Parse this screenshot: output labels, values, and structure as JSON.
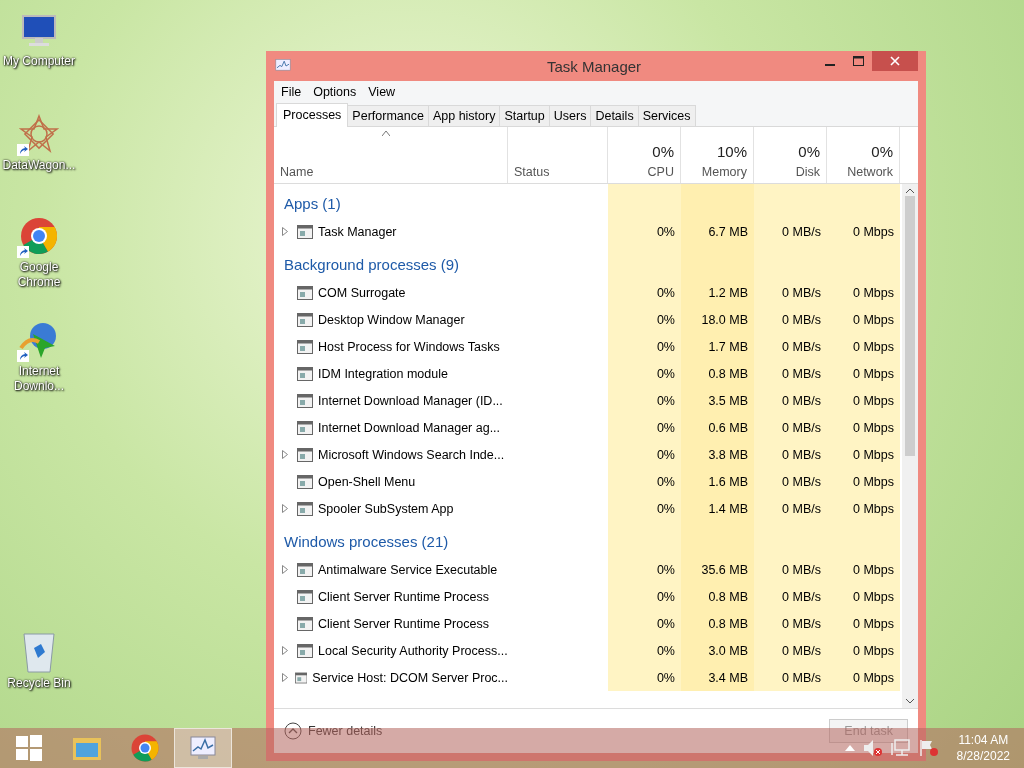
{
  "desktop_icons": [
    {
      "label": "My Computer"
    },
    {
      "label": "DataWagon..."
    },
    {
      "label": "Google Chrome"
    },
    {
      "label": "Internet Downlo..."
    }
  ],
  "recycle_bin": {
    "label": "Recycle Bin"
  },
  "window": {
    "title": "Task Manager"
  },
  "menu": [
    "File",
    "Options",
    "View"
  ],
  "tabs": [
    {
      "label": "Processes",
      "selected": true
    },
    {
      "label": "Performance",
      "selected": false
    },
    {
      "label": "App history",
      "selected": false
    },
    {
      "label": "Startup",
      "selected": false
    },
    {
      "label": "Users",
      "selected": false
    },
    {
      "label": "Details",
      "selected": false
    },
    {
      "label": "Services",
      "selected": false
    }
  ],
  "columns": [
    {
      "label": "Name"
    },
    {
      "label": "Status"
    },
    {
      "label": "CPU",
      "total": "0%"
    },
    {
      "label": "Memory",
      "total": "10%"
    },
    {
      "label": "Disk",
      "total": "0%"
    },
    {
      "label": "Network",
      "total": "0%"
    }
  ],
  "groups": [
    {
      "title": "Apps (1)",
      "rows": [
        {
          "name": "Task Manager",
          "expandable": true,
          "cpu": "0%",
          "memory": "6.7 MB",
          "disk": "0 MB/s",
          "network": "0 Mbps"
        }
      ]
    },
    {
      "title": "Background processes (9)",
      "rows": [
        {
          "name": "COM Surrogate",
          "expandable": false,
          "cpu": "0%",
          "memory": "1.2 MB",
          "disk": "0 MB/s",
          "network": "0 Mbps"
        },
        {
          "name": "Desktop Window Manager",
          "expandable": false,
          "cpu": "0%",
          "memory": "18.0 MB",
          "disk": "0 MB/s",
          "network": "0 Mbps"
        },
        {
          "name": "Host Process for Windows Tasks",
          "expandable": false,
          "cpu": "0%",
          "memory": "1.7 MB",
          "disk": "0 MB/s",
          "network": "0 Mbps"
        },
        {
          "name": "IDM Integration module",
          "expandable": false,
          "cpu": "0%",
          "memory": "0.8 MB",
          "disk": "0 MB/s",
          "network": "0 Mbps"
        },
        {
          "name": "Internet Download Manager (ID...",
          "expandable": false,
          "cpu": "0%",
          "memory": "3.5 MB",
          "disk": "0 MB/s",
          "network": "0 Mbps"
        },
        {
          "name": "Internet Download Manager ag...",
          "expandable": false,
          "cpu": "0%",
          "memory": "0.6 MB",
          "disk": "0 MB/s",
          "network": "0 Mbps"
        },
        {
          "name": "Microsoft Windows Search Inde...",
          "expandable": true,
          "cpu": "0%",
          "memory": "3.8 MB",
          "disk": "0 MB/s",
          "network": "0 Mbps"
        },
        {
          "name": "Open-Shell Menu",
          "expandable": false,
          "cpu": "0%",
          "memory": "1.6 MB",
          "disk": "0 MB/s",
          "network": "0 Mbps"
        },
        {
          "name": "Spooler SubSystem App",
          "expandable": true,
          "cpu": "0%",
          "memory": "1.4 MB",
          "disk": "0 MB/s",
          "network": "0 Mbps"
        }
      ]
    },
    {
      "title": "Windows processes (21)",
      "rows": [
        {
          "name": "Antimalware Service Executable",
          "expandable": true,
          "cpu": "0%",
          "memory": "35.6 MB",
          "disk": "0 MB/s",
          "network": "0 Mbps"
        },
        {
          "name": "Client Server Runtime Process",
          "expandable": false,
          "cpu": "0%",
          "memory": "0.8 MB",
          "disk": "0 MB/s",
          "network": "0 Mbps"
        },
        {
          "name": "Client Server Runtime Process",
          "expandable": false,
          "cpu": "0%",
          "memory": "0.8 MB",
          "disk": "0 MB/s",
          "network": "0 Mbps"
        },
        {
          "name": "Local Security Authority Process...",
          "expandable": true,
          "cpu": "0%",
          "memory": "3.0 MB",
          "disk": "0 MB/s",
          "network": "0 Mbps"
        },
        {
          "name": "Service Host: DCOM Server Proc...",
          "expandable": true,
          "cpu": "0%",
          "memory": "3.4 MB",
          "disk": "0 MB/s",
          "network": "0 Mbps"
        }
      ]
    }
  ],
  "footer": {
    "toggle": "Fewer details",
    "end_task": {
      "label": "End task",
      "disabled": true
    }
  },
  "taskbar": {
    "apps": [
      {
        "selected": false
      },
      {
        "selected": false
      },
      {
        "selected": true
      }
    ],
    "time": "11:04 AM",
    "date": "8/28/2022"
  }
}
